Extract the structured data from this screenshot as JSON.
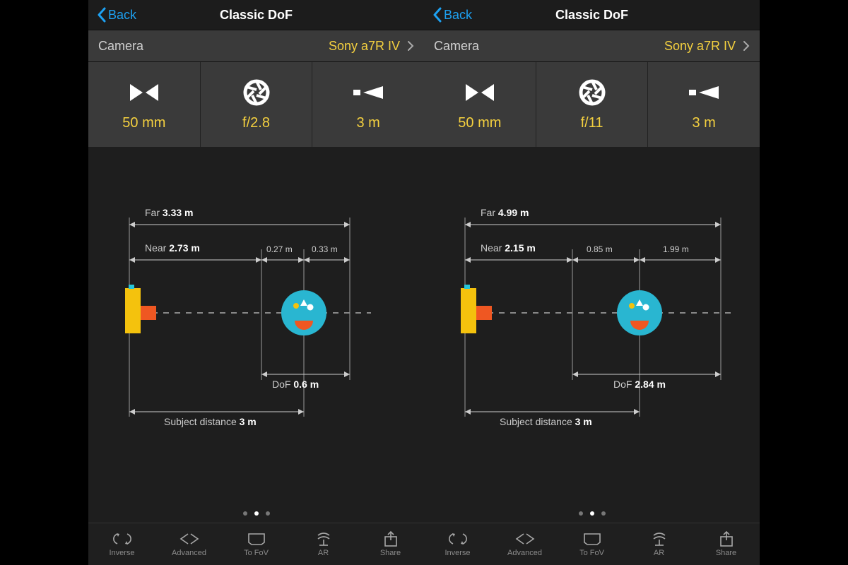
{
  "screens": [
    {
      "back": "Back",
      "title": "Classic DoF",
      "cameraLabel": "Camera",
      "cameraValue": "Sony a7R IV",
      "params": {
        "focal": "50 mm",
        "aperture": "f/2.8",
        "distance": "3 m"
      },
      "diagram": {
        "farLabel": "Far",
        "far": "3.33 m",
        "nearLabel": "Near",
        "near": "2.73 m",
        "nearGap": "0.27 m",
        "farGap": "0.33 m",
        "dofLabel": "DoF",
        "dof": "0.6 m",
        "subjLabel": "Subject distance",
        "subj": "3 m"
      }
    },
    {
      "back": "Back",
      "title": "Classic DoF",
      "cameraLabel": "Camera",
      "cameraValue": "Sony a7R IV",
      "params": {
        "focal": "50 mm",
        "aperture": "f/11",
        "distance": "3 m"
      },
      "diagram": {
        "farLabel": "Far",
        "far": "4.99 m",
        "nearLabel": "Near",
        "near": "2.15 m",
        "nearGap": "0.85 m",
        "farGap": "1.99 m",
        "dofLabel": "DoF",
        "dof": "2.84 m",
        "subjLabel": "Subject distance",
        "subj": "3 m"
      }
    }
  ],
  "toolbar": [
    "Inverse",
    "Advanced",
    "To FoV",
    "AR",
    "Share"
  ],
  "colors": {
    "accent": "#f4d03f",
    "link": "#1da1f2"
  }
}
